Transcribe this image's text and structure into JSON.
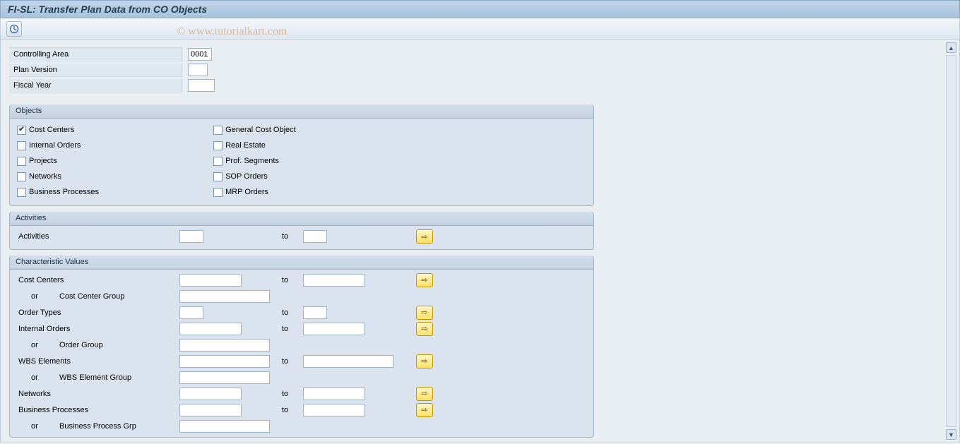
{
  "title": "FI-SL: Transfer Plan Data from CO Objects",
  "watermark": "© www.tutorialkart.com",
  "header_fields": {
    "controlling_area_label": "Controlling Area",
    "controlling_area_value": "0001",
    "plan_version_label": "Plan Version",
    "plan_version_value": "",
    "fiscal_year_label": "Fiscal Year",
    "fiscal_year_value": ""
  },
  "objects": {
    "title": "Objects",
    "left": [
      {
        "label": "Cost Centers",
        "checked": true
      },
      {
        "label": "Internal Orders",
        "checked": false
      },
      {
        "label": "Projects",
        "checked": false
      },
      {
        "label": "Networks",
        "checked": false
      },
      {
        "label": "Business Processes",
        "checked": false
      }
    ],
    "right": [
      {
        "label": "General Cost Object",
        "checked": false
      },
      {
        "label": "Real Estate",
        "checked": false
      },
      {
        "label": "Prof. Segments",
        "checked": false
      },
      {
        "label": "SOP Orders",
        "checked": false
      },
      {
        "label": "MRP Orders",
        "checked": false
      }
    ]
  },
  "activities": {
    "title": "Activities",
    "label": "Activities",
    "to": "to"
  },
  "char_values": {
    "title": "Characteristic Values",
    "rows": [
      {
        "label": "Cost Centers",
        "type": "range"
      },
      {
        "label": "Cost Center Group",
        "type": "or-group",
        "or": "or"
      },
      {
        "label": "Order Types",
        "type": "range-sm"
      },
      {
        "label": "Internal Orders",
        "type": "range"
      },
      {
        "label": "Order Group",
        "type": "or-group",
        "or": "or"
      },
      {
        "label": "WBS Elements",
        "type": "range-wide"
      },
      {
        "label": "WBS Element Group",
        "type": "or-group",
        "or": "or"
      },
      {
        "label": "Networks",
        "type": "range"
      },
      {
        "label": "Business Processes",
        "type": "range"
      },
      {
        "label": "Business Process Grp",
        "type": "or-group",
        "or": "or"
      }
    ],
    "to": "to"
  }
}
